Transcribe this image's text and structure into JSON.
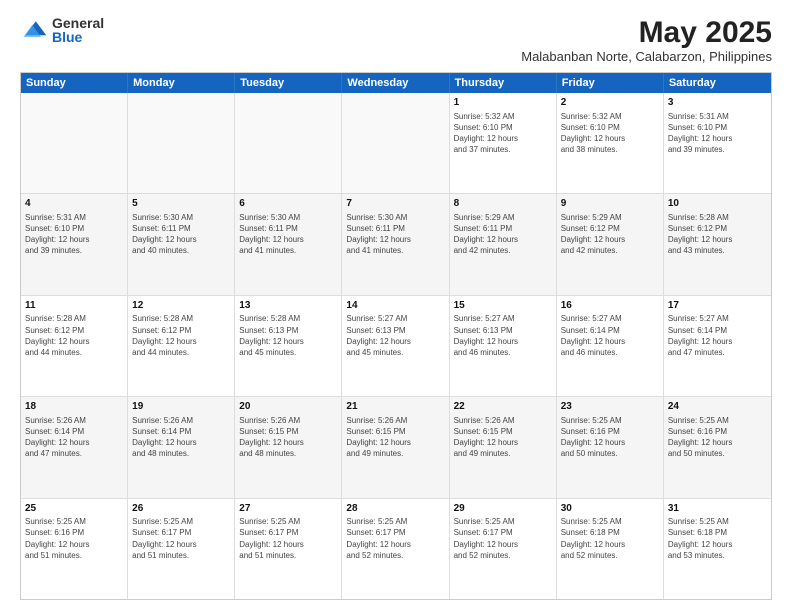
{
  "logo": {
    "general": "General",
    "blue": "Blue"
  },
  "title": "May 2025",
  "subtitle": "Malabanban Norte, Calabarzon, Philippines",
  "header_days": [
    "Sunday",
    "Monday",
    "Tuesday",
    "Wednesday",
    "Thursday",
    "Friday",
    "Saturday"
  ],
  "weeks": [
    [
      {
        "day": "",
        "detail": ""
      },
      {
        "day": "",
        "detail": ""
      },
      {
        "day": "",
        "detail": ""
      },
      {
        "day": "",
        "detail": ""
      },
      {
        "day": "1",
        "detail": "Sunrise: 5:32 AM\nSunset: 6:10 PM\nDaylight: 12 hours\nand 37 minutes."
      },
      {
        "day": "2",
        "detail": "Sunrise: 5:32 AM\nSunset: 6:10 PM\nDaylight: 12 hours\nand 38 minutes."
      },
      {
        "day": "3",
        "detail": "Sunrise: 5:31 AM\nSunset: 6:10 PM\nDaylight: 12 hours\nand 39 minutes."
      }
    ],
    [
      {
        "day": "4",
        "detail": "Sunrise: 5:31 AM\nSunset: 6:10 PM\nDaylight: 12 hours\nand 39 minutes."
      },
      {
        "day": "5",
        "detail": "Sunrise: 5:30 AM\nSunset: 6:11 PM\nDaylight: 12 hours\nand 40 minutes."
      },
      {
        "day": "6",
        "detail": "Sunrise: 5:30 AM\nSunset: 6:11 PM\nDaylight: 12 hours\nand 41 minutes."
      },
      {
        "day": "7",
        "detail": "Sunrise: 5:30 AM\nSunset: 6:11 PM\nDaylight: 12 hours\nand 41 minutes."
      },
      {
        "day": "8",
        "detail": "Sunrise: 5:29 AM\nSunset: 6:11 PM\nDaylight: 12 hours\nand 42 minutes."
      },
      {
        "day": "9",
        "detail": "Sunrise: 5:29 AM\nSunset: 6:12 PM\nDaylight: 12 hours\nand 42 minutes."
      },
      {
        "day": "10",
        "detail": "Sunrise: 5:28 AM\nSunset: 6:12 PM\nDaylight: 12 hours\nand 43 minutes."
      }
    ],
    [
      {
        "day": "11",
        "detail": "Sunrise: 5:28 AM\nSunset: 6:12 PM\nDaylight: 12 hours\nand 44 minutes."
      },
      {
        "day": "12",
        "detail": "Sunrise: 5:28 AM\nSunset: 6:12 PM\nDaylight: 12 hours\nand 44 minutes."
      },
      {
        "day": "13",
        "detail": "Sunrise: 5:28 AM\nSunset: 6:13 PM\nDaylight: 12 hours\nand 45 minutes."
      },
      {
        "day": "14",
        "detail": "Sunrise: 5:27 AM\nSunset: 6:13 PM\nDaylight: 12 hours\nand 45 minutes."
      },
      {
        "day": "15",
        "detail": "Sunrise: 5:27 AM\nSunset: 6:13 PM\nDaylight: 12 hours\nand 46 minutes."
      },
      {
        "day": "16",
        "detail": "Sunrise: 5:27 AM\nSunset: 6:14 PM\nDaylight: 12 hours\nand 46 minutes."
      },
      {
        "day": "17",
        "detail": "Sunrise: 5:27 AM\nSunset: 6:14 PM\nDaylight: 12 hours\nand 47 minutes."
      }
    ],
    [
      {
        "day": "18",
        "detail": "Sunrise: 5:26 AM\nSunset: 6:14 PM\nDaylight: 12 hours\nand 47 minutes."
      },
      {
        "day": "19",
        "detail": "Sunrise: 5:26 AM\nSunset: 6:14 PM\nDaylight: 12 hours\nand 48 minutes."
      },
      {
        "day": "20",
        "detail": "Sunrise: 5:26 AM\nSunset: 6:15 PM\nDaylight: 12 hours\nand 48 minutes."
      },
      {
        "day": "21",
        "detail": "Sunrise: 5:26 AM\nSunset: 6:15 PM\nDaylight: 12 hours\nand 49 minutes."
      },
      {
        "day": "22",
        "detail": "Sunrise: 5:26 AM\nSunset: 6:15 PM\nDaylight: 12 hours\nand 49 minutes."
      },
      {
        "day": "23",
        "detail": "Sunrise: 5:25 AM\nSunset: 6:16 PM\nDaylight: 12 hours\nand 50 minutes."
      },
      {
        "day": "24",
        "detail": "Sunrise: 5:25 AM\nSunset: 6:16 PM\nDaylight: 12 hours\nand 50 minutes."
      }
    ],
    [
      {
        "day": "25",
        "detail": "Sunrise: 5:25 AM\nSunset: 6:16 PM\nDaylight: 12 hours\nand 51 minutes."
      },
      {
        "day": "26",
        "detail": "Sunrise: 5:25 AM\nSunset: 6:17 PM\nDaylight: 12 hours\nand 51 minutes."
      },
      {
        "day": "27",
        "detail": "Sunrise: 5:25 AM\nSunset: 6:17 PM\nDaylight: 12 hours\nand 51 minutes."
      },
      {
        "day": "28",
        "detail": "Sunrise: 5:25 AM\nSunset: 6:17 PM\nDaylight: 12 hours\nand 52 minutes."
      },
      {
        "day": "29",
        "detail": "Sunrise: 5:25 AM\nSunset: 6:17 PM\nDaylight: 12 hours\nand 52 minutes."
      },
      {
        "day": "30",
        "detail": "Sunrise: 5:25 AM\nSunset: 6:18 PM\nDaylight: 12 hours\nand 52 minutes."
      },
      {
        "day": "31",
        "detail": "Sunrise: 5:25 AM\nSunset: 6:18 PM\nDaylight: 12 hours\nand 53 minutes."
      }
    ]
  ]
}
